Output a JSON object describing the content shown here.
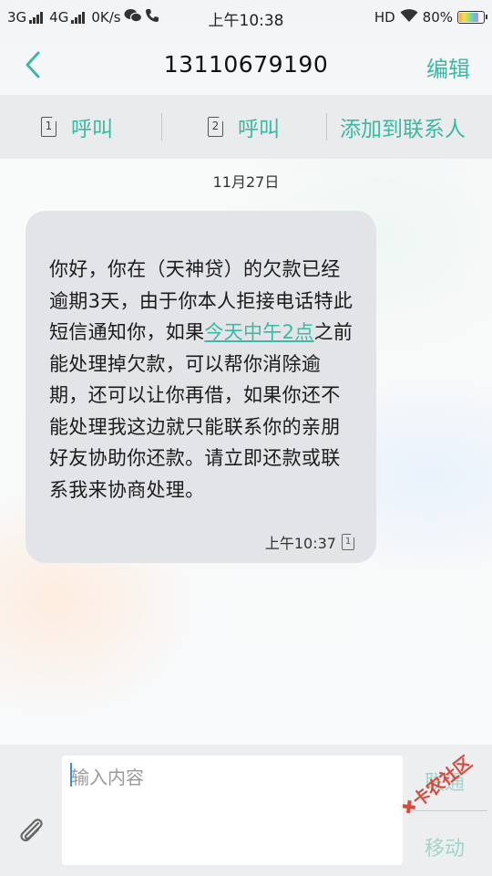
{
  "status_bar": {
    "network1": "3G",
    "network2": "4G",
    "speed": "0K/s",
    "time": "上午10:38",
    "hd": "HD",
    "battery": "80%",
    "battery_level": 0.8
  },
  "header": {
    "title": "13110679190",
    "edit_label": "编辑"
  },
  "actions": {
    "call1_sim": "1",
    "call1_label": "呼叫",
    "call2_sim": "2",
    "call2_label": "呼叫",
    "add_contact_label": "添加到联系人"
  },
  "conversation": {
    "date": "11月27日",
    "message": {
      "text_before_link": "你好，你在（天神贷）的欠款已经逾期3天，由于你本人拒接电话特此短信通知你，如果",
      "link_text": "今天中午2点",
      "text_after_link": "之前能处理掉欠款，可以帮你消除逾期，还可以让你再借，如果你还不能处理我这边就只能联系你的亲朋好友协助你还款。请立即还款或联系我来协商处理。",
      "time": "上午10:37",
      "sim": "1"
    }
  },
  "compose": {
    "placeholder": "输入内容",
    "send_sim1_label": "联通",
    "send_sim2_label": "移动"
  },
  "watermark": "卡农社区",
  "colors": {
    "accent": "#3cb8a4",
    "bubble": "#e3e4e7",
    "action_bar": "#e9ebec"
  }
}
